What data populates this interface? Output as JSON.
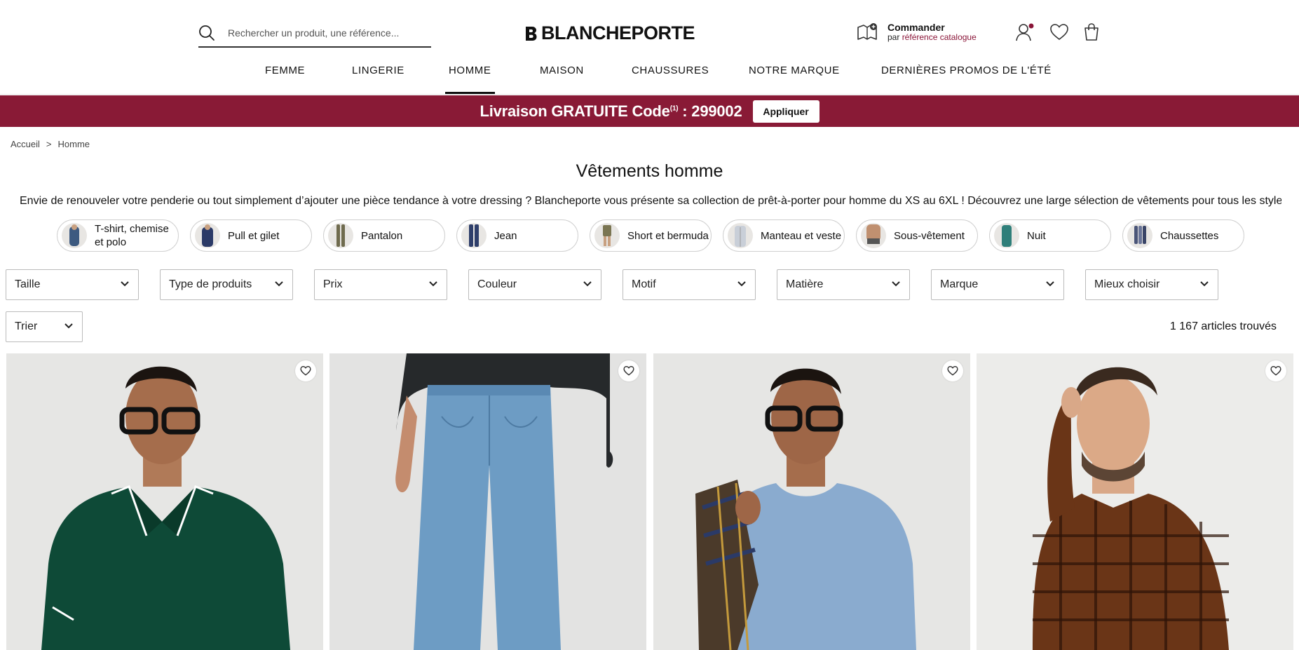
{
  "header": {
    "search_placeholder": "Rechercher un produit, une référence...",
    "logo_text": "BLANCHEPORTE",
    "order_title": "Commander",
    "order_sub_prefix": "par ",
    "order_sub_link": "référence catalogue"
  },
  "nav": {
    "items": [
      {
        "label": "FEMME"
      },
      {
        "label": "LINGERIE"
      },
      {
        "label": "HOMME"
      },
      {
        "label": "MAISON"
      },
      {
        "label": "CHAUSSURES"
      },
      {
        "label": "NOTRE MARQUE"
      },
      {
        "label": "DERNIÈRES PROMOS DE L'ÉTÉ"
      }
    ],
    "active": "HOMME"
  },
  "banner": {
    "text_main": "Livraison GRATUITE Code",
    "sup": "(1)",
    "code": " : 299002",
    "apply_label": "Appliquer"
  },
  "breadcrumb": {
    "home": "Accueil",
    "separator": ">",
    "current": "Homme"
  },
  "page": {
    "title": "Vêtements homme",
    "intro": "Envie de renouveler votre penderie ou tout simplement d’ajouter une pièce tendance à votre dressing ? Blancheporte vous présente sa collection de prêt-à-porter pour homme du XS au 6XL ! Découvrez une large sélection de vêtements pour tous les styles et..."
  },
  "categories": [
    {
      "label": "T-shirt, chemise et polo",
      "color": "#3d5a80"
    },
    {
      "label": "Pull et gilet",
      "color": "#2b3a67"
    },
    {
      "label": "Pantalon",
      "color": "#6f6b4e"
    },
    {
      "label": "Jean",
      "color": "#2f3f6b"
    },
    {
      "label": "Short et bermuda",
      "color": "#7a7552"
    },
    {
      "label": "Manteau et veste",
      "color": "#c9cfd8"
    },
    {
      "label": "Sous-vêtement",
      "color": "#b08060"
    },
    {
      "label": "Nuit",
      "color": "#2f7f7a"
    },
    {
      "label": "Chaussettes",
      "color": "#4a5578"
    }
  ],
  "filters": [
    {
      "label": "Taille"
    },
    {
      "label": "Type de produits"
    },
    {
      "label": "Prix"
    },
    {
      "label": "Couleur"
    },
    {
      "label": "Motif"
    },
    {
      "label": "Matière"
    },
    {
      "label": "Marque"
    },
    {
      "label": "Mieux choisir"
    }
  ],
  "sort": {
    "label": "Trier"
  },
  "results": {
    "count_text": "1 167 articles trouvés"
  },
  "products": [
    {
      "name": "green-polo",
      "garment_color": "#0e4a37"
    },
    {
      "name": "light-jeans",
      "garment_color": "#6d9cc4"
    },
    {
      "name": "blue-tshirt",
      "garment_color": "#8aabcf"
    },
    {
      "name": "check-shirt",
      "garment_color": "#6a3517"
    }
  ],
  "colors": {
    "brand": "#891a36",
    "notification_dot": "#8a1538"
  }
}
